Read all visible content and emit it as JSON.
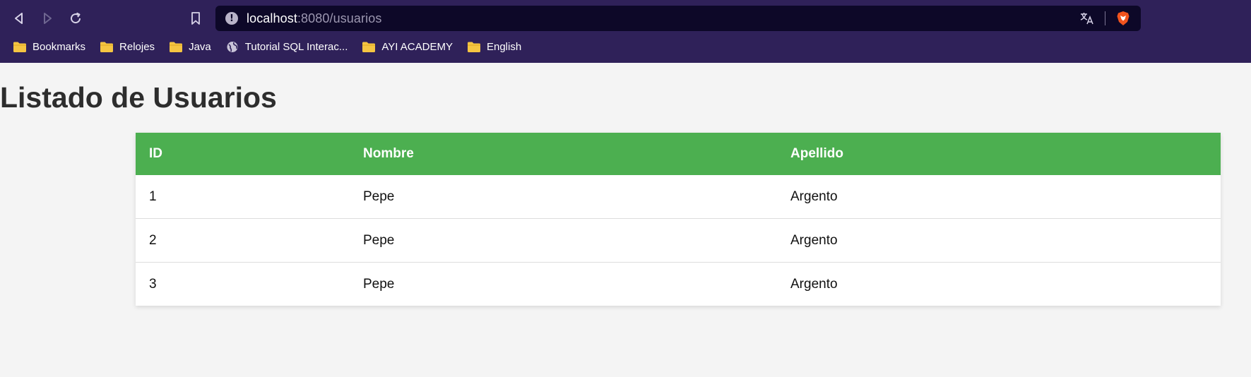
{
  "browser": {
    "url_host": "localhost",
    "url_rest": ":8080/usuarios",
    "bookmarks": [
      {
        "label": "Bookmarks",
        "icon": "folder-icon"
      },
      {
        "label": "Relojes",
        "icon": "folder-icon"
      },
      {
        "label": "Java",
        "icon": "folder-icon"
      },
      {
        "label": "Tutorial SQL Interac...",
        "icon": "globe-icon"
      },
      {
        "label": "AYI ACADEMY",
        "icon": "folder-icon"
      },
      {
        "label": "English",
        "icon": "folder-icon"
      }
    ]
  },
  "page": {
    "title": "Listado de Usuarios",
    "table": {
      "headers": [
        "ID",
        "Nombre",
        "Apellido"
      ],
      "rows": [
        [
          "1",
          "Pepe",
          "Argento"
        ],
        [
          "2",
          "Pepe",
          "Argento"
        ],
        [
          "3",
          "Pepe",
          "Argento"
        ]
      ]
    }
  },
  "colors": {
    "chrome_bg": "#2f2159",
    "url_bar_bg": "#0d0828",
    "table_header_bg": "#4caf50",
    "page_bg": "#f4f4f4"
  }
}
